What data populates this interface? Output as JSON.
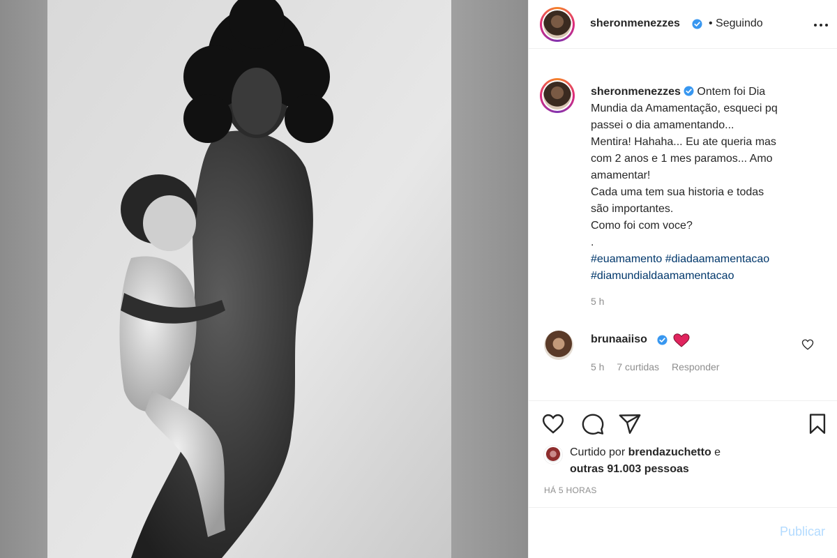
{
  "post": {
    "author": "sheronmenezzes",
    "follow_status": "• Seguindo"
  },
  "caption": {
    "username": "sheronmenezzes",
    "lines": [
      "Ontem foi Dia",
      "Mundia da Amamentação, esqueci pq",
      "passei o dia amamentando...",
      "Mentira! Hahaha... Eu ate queria mas",
      "com 2 anos e 1 mes paramos... Amo",
      "amamentar!",
      "Cada uma tem sua historia e todas",
      "são importantes.",
      "Como foi com voce?",
      "."
    ],
    "hashtags": [
      "#euamamento #diadaamamentacao",
      "#diamundialdaamamentacao"
    ],
    "time": "5 h"
  },
  "comment": {
    "username": "brunaaiiso",
    "emoji": "heart-emoji",
    "time": "5 h",
    "likes": "7 curtidas",
    "reply": "Responder"
  },
  "engagement": {
    "liked_prefix": "Curtido por ",
    "liked_user": "brendazuchetto",
    "liked_suffix": " e",
    "others": "outras 91.003 pessoas",
    "when": "HÁ 5 HORAS"
  },
  "composer": {
    "placeholder": "",
    "publish_label": "Publicar"
  },
  "icons": {
    "more": "more-dots-icon",
    "like": "heart-outline-icon",
    "comment": "comment-bubble-icon",
    "share": "paper-plane-icon",
    "save": "bookmark-icon",
    "verified": "verified-badge-icon"
  },
  "colors": {
    "verified": "#3897f0",
    "hashtag": "#00376b",
    "muted": "#8e8e8e",
    "publish_disabled": "#b3dbff",
    "heart_red": "#e0245e"
  }
}
